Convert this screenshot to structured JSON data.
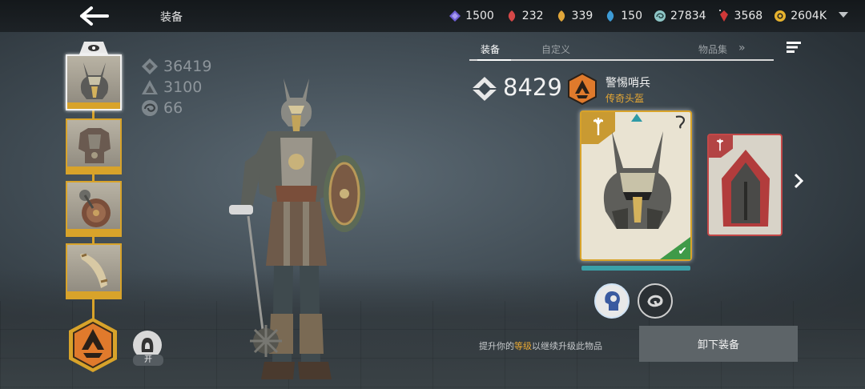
{
  "header": {
    "title": "装备",
    "resources": [
      {
        "icon": "purple-gem-icon",
        "value": "1500",
        "color": "#6f5fd6"
      },
      {
        "icon": "red-leaf-icon",
        "value": "232",
        "color": "#d64848"
      },
      {
        "icon": "gold-leaf-icon",
        "value": "339",
        "color": "#e0a63a"
      },
      {
        "icon": "blue-leaf-icon",
        "value": "150",
        "color": "#3d9bd6"
      },
      {
        "icon": "swirl-orb-icon",
        "value": "27834",
        "color": "#8fc7c7"
      },
      {
        "icon": "red-crystal-icon",
        "value": "3568",
        "color": "#d03838"
      },
      {
        "icon": "gold-coin-icon",
        "value": "2604K",
        "color": "#e7b32e"
      }
    ]
  },
  "stats": {
    "gear_score": "36419",
    "power": "3100",
    "level": "66"
  },
  "helmet_toggle_label": "开",
  "tabs": [
    {
      "label": "装备",
      "active": true
    },
    {
      "label": "自定义",
      "active": false
    },
    {
      "label": "物品集",
      "active": false
    }
  ],
  "item": {
    "score": "8429",
    "name": "警惕哨兵",
    "type": "传奇头盔"
  },
  "hint": {
    "prefix": "提升你的",
    "highlight": "等级",
    "suffix": "以继续升级此物品"
  },
  "unequip_label": "卸下装备",
  "colors": {
    "gold": "#d8a32a",
    "accent_orange": "#e7a834",
    "equipped_green": "#3f9a48"
  }
}
